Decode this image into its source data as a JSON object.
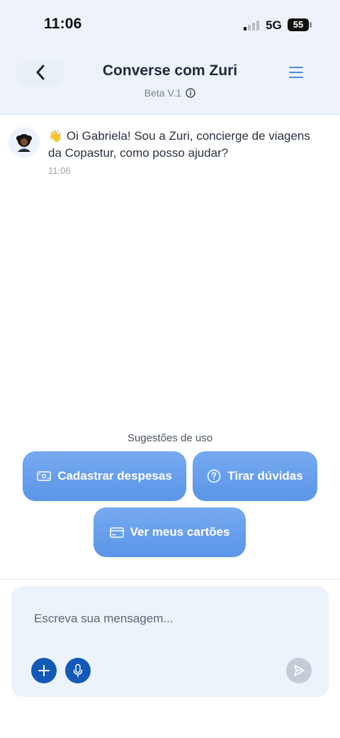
{
  "status_bar": {
    "time": "11:06",
    "network": "5G",
    "battery": "55"
  },
  "header": {
    "title": "Converse com Zuri",
    "subtitle": "Beta V.1",
    "back_icon": "chevron-left-icon",
    "menu_icon": "hamburger-menu-icon",
    "info_icon": "info-circle-icon"
  },
  "chat": {
    "messages": [
      {
        "sender_icon": "zuri-avatar",
        "emoji": "👋",
        "text": "Oi Gabriela! Sou a Zuri, concierge de viagens da Copastur, como posso ajudar?",
        "time": "11:06"
      }
    ]
  },
  "suggestions": {
    "title": "Sugestões de uso",
    "items": [
      {
        "label": "Cadastrar despesas",
        "icon": "banknote-icon"
      },
      {
        "label": "Tirar dúvidas",
        "icon": "question-circle-icon"
      },
      {
        "label": "Ver meus cartões",
        "icon": "credit-card-icon"
      }
    ]
  },
  "composer": {
    "placeholder": "Escreva sua mensagem...",
    "add_icon": "plus-icon",
    "mic_icon": "microphone-icon",
    "send_icon": "send-icon"
  },
  "colors": {
    "header_bg": "#eef3fb",
    "chip_bg": "#6aa0ee",
    "action_blue": "#1459b7",
    "send_disabled": "#c4cdd7"
  }
}
